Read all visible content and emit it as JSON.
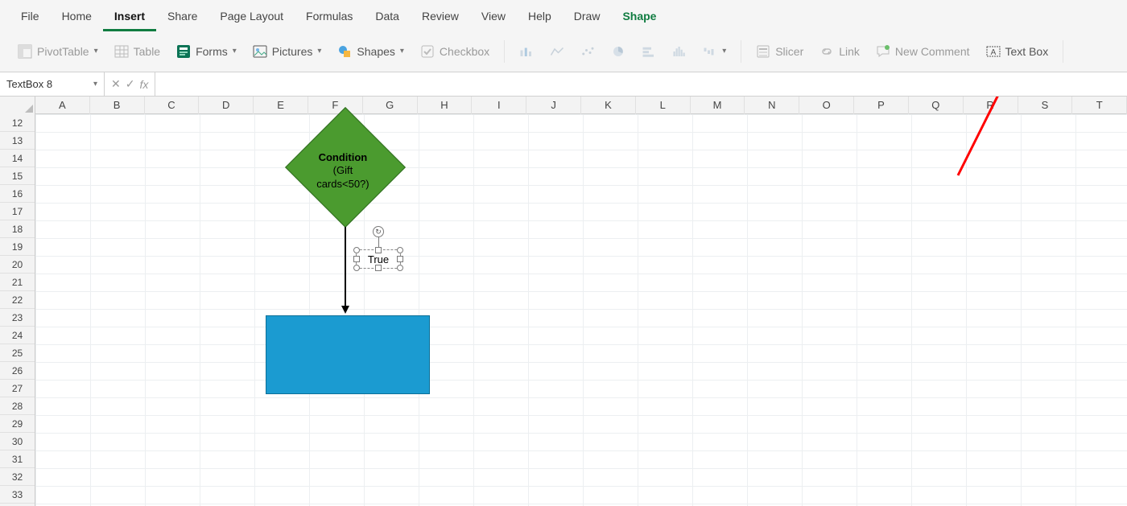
{
  "tabs": {
    "file": "File",
    "home": "Home",
    "insert": "Insert",
    "share": "Share",
    "page_layout": "Page Layout",
    "formulas": "Formulas",
    "data": "Data",
    "review": "Review",
    "view": "View",
    "help": "Help",
    "draw": "Draw",
    "shape": "Shape"
  },
  "ribbon": {
    "pivot_table": "PivotTable",
    "table": "Table",
    "forms": "Forms",
    "pictures": "Pictures",
    "shapes": "Shapes",
    "checkbox": "Checkbox",
    "slicer": "Slicer",
    "link": "Link",
    "new_comment": "New Comment",
    "text_box": "Text Box"
  },
  "name_box": {
    "value": "TextBox 8"
  },
  "formula_bar": {
    "fx": "fx",
    "value": ""
  },
  "grid": {
    "columns": [
      "A",
      "B",
      "C",
      "D",
      "E",
      "F",
      "G",
      "H",
      "I",
      "J",
      "K",
      "L",
      "M",
      "N",
      "O",
      "P",
      "Q",
      "R",
      "S",
      "T"
    ],
    "row_start": 12,
    "row_end": 33
  },
  "shapes": {
    "diamond": {
      "line1": "Condition",
      "line2": "(Gift",
      "line3": "cards<50?)"
    },
    "textbox": {
      "text": "True"
    }
  },
  "colors": {
    "diamond_fill": "#4b9b2f",
    "rect_fill": "#1b9bd1",
    "annotation": "#ff0000",
    "excel_green": "#107c41"
  }
}
